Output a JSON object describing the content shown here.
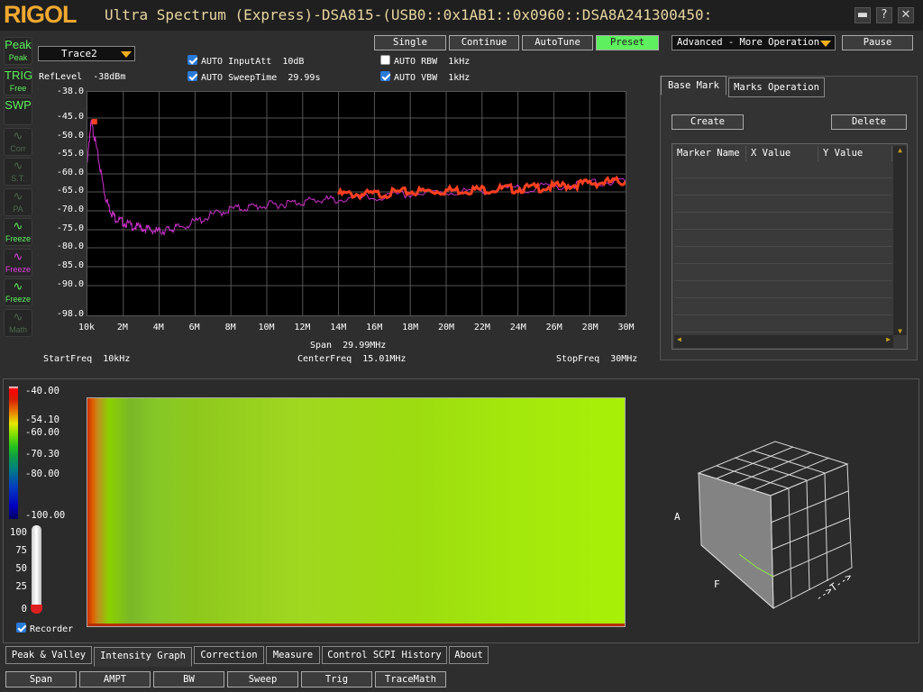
{
  "titlebar": {
    "logo": "RIGOL",
    "title": "Ultra Spectrum (Express)-DSA815-(USB0::0x1AB1::0x0960::DSA8A241300450:"
  },
  "side_buttons": [
    {
      "icon": "Peak",
      "label": "Peak"
    },
    {
      "icon": "TRIG",
      "label": "Free"
    },
    {
      "icon": "SWP",
      "label": ""
    },
    {
      "icon": "",
      "label": "Corr"
    },
    {
      "icon": "",
      "label": "S.T."
    },
    {
      "icon": "",
      "label": "PA"
    },
    {
      "icon": "",
      "label": "Freeze"
    },
    {
      "icon": "",
      "label": "Freeze"
    },
    {
      "icon": "",
      "label": "Freeze"
    },
    {
      "icon": "",
      "label": "Math"
    }
  ],
  "trace": {
    "selected": "Trace2"
  },
  "settings": {
    "input_att_label": "AUTO InputAtt",
    "input_att_value": "10dB",
    "sweep_time_label": "AUTO SweepTime",
    "sweep_time_value": "29.99s",
    "rbw_label": "AUTO RBW",
    "rbw_value": "1kHz",
    "vbw_label": "AUTO VBW",
    "vbw_value": "1kHz",
    "reflevel_label": "RefLevel",
    "reflevel_value": "-38dBm"
  },
  "toolbar": {
    "single": "Single",
    "continue": "Continue",
    "autotune": "AutoTune",
    "preset": "Preset",
    "advanced": "Advanced - More Operation",
    "pause": "Pause"
  },
  "freq": {
    "span_label": "Span",
    "span": "29.99MHz",
    "start_label": "StartFreq",
    "start": "10kHz",
    "center_label": "CenterFreq",
    "center": "15.01MHz",
    "stop_label": "StopFreq",
    "stop": "30MHz"
  },
  "chart_data": {
    "type": "line",
    "ylim": [
      -98,
      -38
    ],
    "xlim": [
      0.01,
      30
    ],
    "yticks": [
      "-38.0",
      "-45.0",
      "-50.0",
      "-55.0",
      "-60.0",
      "-65.0",
      "-70.0",
      "-75.0",
      "-80.0",
      "-85.0",
      "-90.0",
      "-98.0"
    ],
    "xticks": [
      "10k",
      "2M",
      "4M",
      "6M",
      "8M",
      "10M",
      "12M",
      "14M",
      "16M",
      "18M",
      "20M",
      "22M",
      "24M",
      "26M",
      "28M",
      "30M"
    ],
    "series": [
      {
        "color": "#d030d0",
        "x": [
          0.01,
          0.2,
          0.4,
          0.7,
          1,
          1.3,
          1.6,
          2,
          2.5,
          3,
          3.5,
          4,
          4.5,
          5,
          6,
          7,
          8,
          9,
          10,
          11,
          12,
          13,
          14,
          16,
          18,
          20,
          22,
          24,
          26,
          28,
          30
        ],
        "y": [
          -57,
          -46,
          -50,
          -58,
          -66,
          -70,
          -72,
          -73,
          -74,
          -74.5,
          -75,
          -75.5,
          -75,
          -74.5,
          -73,
          -71,
          -69.5,
          -69,
          -68.5,
          -68,
          -67.5,
          -67,
          -67,
          -66.5,
          -65.5,
          -65,
          -64.5,
          -64,
          -63.5,
          -62.5,
          -62
        ]
      },
      {
        "color": "#ff4020",
        "x": [
          14,
          16,
          18,
          20,
          22,
          24,
          26,
          28,
          30
        ],
        "y": [
          -65.5,
          -65.5,
          -64.8,
          -64.5,
          -64.2,
          -64,
          -63.5,
          -62.5,
          -62
        ]
      }
    ],
    "marker": {
      "x": 0.4,
      "y": -46
    }
  },
  "markers": {
    "tab_base": "Base Mark",
    "tab_ops": "Marks Operation",
    "create": "Create",
    "delete": "Delete",
    "col_name": "Marker Name",
    "col_x": "X Value",
    "col_y": "Y Value"
  },
  "intensity": {
    "colorbar_labels": [
      "-40.00",
      "-54.10",
      "-60.00",
      "-70.30",
      "-80.00",
      "-100.00"
    ],
    "slider_labels": [
      "100",
      "75",
      "50",
      "25",
      "0"
    ],
    "recorder": "Recorder",
    "axis_f": "F",
    "axis_t": "-->T-->",
    "axis_a": "A"
  },
  "bottom_tabs": [
    "Peak & Valley",
    "Intensity Graph",
    "Correction",
    "Measure",
    "Control SCPI History",
    "About"
  ],
  "bottom_buttons": [
    "Span",
    "AMPT",
    "BW",
    "Sweep",
    "Trig",
    "TraceMath"
  ]
}
